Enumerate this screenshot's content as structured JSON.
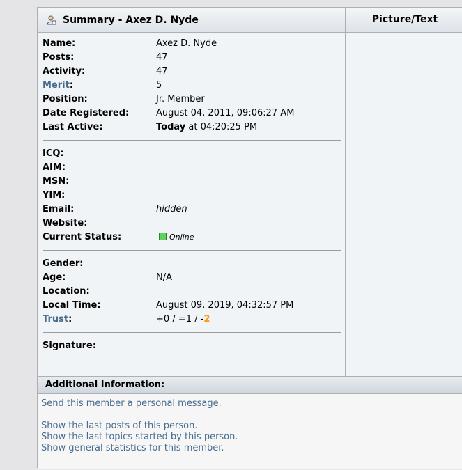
{
  "header": {
    "title": "Summary - Axez D. Nyde",
    "picture_text": "Picture/Text",
    "icon": "user-profile-icon"
  },
  "profile": {
    "name_label": "Name:",
    "name_value": "Axez D. Nyde",
    "posts_label": "Posts:",
    "posts_value": "47",
    "activity_label": "Activity:",
    "activity_value": "47",
    "merit_label": "Merit",
    "merit_colon": ":",
    "merit_value": "5",
    "position_label": "Position:",
    "position_value": "Jr. Member",
    "registered_label": "Date Registered:",
    "registered_value": "August 04, 2011, 09:06:27 AM",
    "last_active_label": "Last Active:",
    "last_active_bold": "Today",
    "last_active_rest": " at 04:20:25 PM"
  },
  "contact": {
    "icq_label": "ICQ:",
    "aim_label": "AIM:",
    "msn_label": "MSN:",
    "yim_label": "YIM:",
    "email_label": "Email:",
    "email_value": "hidden",
    "website_label": "Website:",
    "status_label": "Current Status:",
    "status_value": "Online",
    "status_color": "#5fd35f"
  },
  "personal": {
    "gender_label": "Gender:",
    "age_label": "Age:",
    "age_value": "N/A",
    "location_label": "Location:",
    "local_time_label": "Local Time:",
    "local_time_value": "August 09, 2019, 04:32:57 PM",
    "trust_label": "Trust",
    "trust_colon": ":",
    "trust_value": "+0 / =1 / -",
    "trust_negative": "2"
  },
  "signature": {
    "label": "Signature:"
  },
  "additional": {
    "title": "Additional Information:",
    "links": [
      "Send this member a personal message.",
      "Show the last posts of this person.",
      "Show the last topics started by this person.",
      "Show general statistics for this member."
    ]
  },
  "colors": {
    "link": "#476c8e",
    "accent_orange": "#ff9900"
  }
}
